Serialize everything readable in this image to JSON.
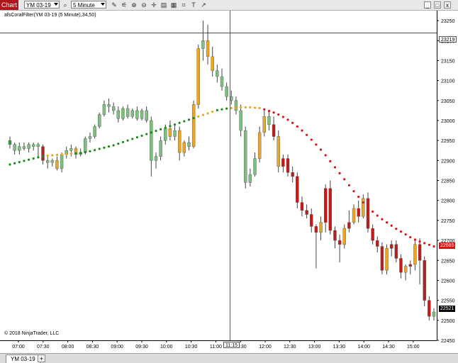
{
  "toolbar": {
    "chart_tab": "Chart",
    "instrument": "YM 03-19",
    "interval": "5 Minute",
    "icons": [
      "search-icon",
      "pencil-icon",
      "zoom-in-icon",
      "zoom-out-icon",
      "crosshair-icon",
      "properties-icon",
      "template-icon",
      "data-box-icon",
      "show-text-icon",
      "share-icon"
    ]
  },
  "window": {
    "minimize": "_",
    "maximize": "□",
    "close": "x"
  },
  "indicator_label": "afsCoralFilter(YM 03-19 (5 Minute),34,50)",
  "copyright": "© 2018 NinjaTrader, LLC",
  "crosshair": {
    "price_label": "23219",
    "time_label": "11:15"
  },
  "last_price": "22521",
  "filter_price": "22685",
  "colors": {
    "bull": "#7dc07d",
    "bear": "#c21a1a",
    "neutral": "#e8a623",
    "filter_up": "#1a8a1a",
    "filter_mid": "#e8a623",
    "filter_down": "#e01010"
  },
  "bottom": {
    "instrument_tab": "YM 03-19",
    "add_tab": "+"
  },
  "chart_data": {
    "type": "candlestick",
    "y_ticks": [
      "23250",
      "23200",
      "23150",
      "23100",
      "23050",
      "23000",
      "22950",
      "22900",
      "22850",
      "22800",
      "22750",
      "22700",
      "22650",
      "22600",
      "22550",
      "22500",
      "22450"
    ],
    "x_ticks": [
      "07:00",
      "07:30",
      "08:00",
      "08:30",
      "09:00",
      "09:30",
      "10:00",
      "10:30",
      "11:00",
      "11:30",
      "12:00",
      "12:30",
      "13:00",
      "13:30",
      "14:00",
      "14:30",
      "15:00"
    ],
    "ylim": [
      22450,
      23275
    ],
    "candles": [
      {
        "o": 22950,
        "h": 22960,
        "l": 22930,
        "c": 22940,
        "s": "b"
      },
      {
        "o": 22940,
        "h": 22945,
        "l": 22915,
        "c": 22925,
        "s": "g"
      },
      {
        "o": 22925,
        "h": 22945,
        "l": 22915,
        "c": 22935,
        "s": "g"
      },
      {
        "o": 22935,
        "h": 22945,
        "l": 22925,
        "c": 22930,
        "s": "g"
      },
      {
        "o": 22930,
        "h": 22945,
        "l": 22920,
        "c": 22940,
        "s": "g"
      },
      {
        "o": 22940,
        "h": 22945,
        "l": 22925,
        "c": 22935,
        "s": "g"
      },
      {
        "o": 22935,
        "h": 22945,
        "l": 22910,
        "c": 22940,
        "s": "g"
      },
      {
        "o": 22935,
        "h": 22940,
        "l": 22890,
        "c": 22900,
        "s": "r"
      },
      {
        "o": 22900,
        "h": 22910,
        "l": 22880,
        "c": 22895,
        "s": "g"
      },
      {
        "o": 22895,
        "h": 22905,
        "l": 22885,
        "c": 22900,
        "s": "g"
      },
      {
        "o": 22900,
        "h": 22910,
        "l": 22875,
        "c": 22880,
        "s": "n"
      },
      {
        "o": 22880,
        "h": 22920,
        "l": 22870,
        "c": 22915,
        "s": "g"
      },
      {
        "o": 22915,
        "h": 22935,
        "l": 22905,
        "c": 22925,
        "s": "g"
      },
      {
        "o": 22925,
        "h": 22940,
        "l": 22910,
        "c": 22930,
        "s": "g"
      },
      {
        "o": 22930,
        "h": 22935,
        "l": 22905,
        "c": 22915,
        "s": "n"
      },
      {
        "o": 22915,
        "h": 22930,
        "l": 22910,
        "c": 22920,
        "s": "g"
      },
      {
        "o": 22920,
        "h": 22960,
        "l": 22915,
        "c": 22955,
        "s": "g"
      },
      {
        "o": 22955,
        "h": 22970,
        "l": 22945,
        "c": 22960,
        "s": "g"
      },
      {
        "o": 22960,
        "h": 22990,
        "l": 22955,
        "c": 22985,
        "s": "g"
      },
      {
        "o": 22985,
        "h": 23020,
        "l": 22980,
        "c": 23015,
        "s": "g"
      },
      {
        "o": 23015,
        "h": 23050,
        "l": 23010,
        "c": 23040,
        "s": "g"
      },
      {
        "o": 23040,
        "h": 23055,
        "l": 23020,
        "c": 23035,
        "s": "g"
      },
      {
        "o": 23035,
        "h": 23045,
        "l": 23015,
        "c": 23025,
        "s": "g"
      },
      {
        "o": 23025,
        "h": 23035,
        "l": 22995,
        "c": 23005,
        "s": "g"
      },
      {
        "o": 23005,
        "h": 23035,
        "l": 23000,
        "c": 23030,
        "s": "g"
      },
      {
        "o": 23030,
        "h": 23040,
        "l": 23005,
        "c": 23010,
        "s": "g"
      },
      {
        "o": 23010,
        "h": 23030,
        "l": 23005,
        "c": 23025,
        "s": "g"
      },
      {
        "o": 23025,
        "h": 23035,
        "l": 23000,
        "c": 23005,
        "s": "g"
      },
      {
        "o": 23005,
        "h": 23030,
        "l": 23000,
        "c": 23025,
        "s": "g"
      },
      {
        "o": 23025,
        "h": 23035,
        "l": 22995,
        "c": 23000,
        "s": "g"
      },
      {
        "o": 23000,
        "h": 23010,
        "l": 22860,
        "c": 22900,
        "s": "g"
      },
      {
        "o": 22900,
        "h": 22920,
        "l": 22880,
        "c": 22910,
        "s": "g"
      },
      {
        "o": 22910,
        "h": 22960,
        "l": 22900,
        "c": 22950,
        "s": "g"
      },
      {
        "o": 22950,
        "h": 22990,
        "l": 22940,
        "c": 22980,
        "s": "g"
      },
      {
        "o": 22980,
        "h": 23000,
        "l": 22950,
        "c": 22960,
        "s": "n"
      },
      {
        "o": 22960,
        "h": 22990,
        "l": 22950,
        "c": 22975,
        "s": "g"
      },
      {
        "o": 22975,
        "h": 22985,
        "l": 22900,
        "c": 22920,
        "s": "n"
      },
      {
        "o": 22920,
        "h": 22950,
        "l": 22910,
        "c": 22945,
        "s": "n"
      },
      {
        "o": 22945,
        "h": 22960,
        "l": 22925,
        "c": 22935,
        "s": "g"
      },
      {
        "o": 22935,
        "h": 23050,
        "l": 22930,
        "c": 23040,
        "s": "n"
      },
      {
        "o": 23040,
        "h": 23190,
        "l": 23030,
        "c": 23180,
        "s": "n"
      },
      {
        "o": 23180,
        "h": 23250,
        "l": 23150,
        "c": 23200,
        "s": "g"
      },
      {
        "o": 23200,
        "h": 23240,
        "l": 23140,
        "c": 23160,
        "s": "n"
      },
      {
        "o": 23160,
        "h": 23185,
        "l": 23110,
        "c": 23125,
        "s": "n"
      },
      {
        "o": 23125,
        "h": 23140,
        "l": 23095,
        "c": 23110,
        "s": "g"
      },
      {
        "o": 23110,
        "h": 23130,
        "l": 23075,
        "c": 23085,
        "s": "g"
      },
      {
        "o": 23085,
        "h": 23095,
        "l": 23050,
        "c": 23060,
        "s": "g"
      },
      {
        "o": 23060,
        "h": 23075,
        "l": 23040,
        "c": 23050,
        "s": "g"
      },
      {
        "o": 23050,
        "h": 23060,
        "l": 23015,
        "c": 23025,
        "s": "g"
      },
      {
        "o": 23025,
        "h": 23040,
        "l": 22960,
        "c": 22975,
        "s": "g"
      },
      {
        "o": 22975,
        "h": 22985,
        "l": 22830,
        "c": 22845,
        "s": "g"
      },
      {
        "o": 22845,
        "h": 22880,
        "l": 22835,
        "c": 22865,
        "s": "g"
      },
      {
        "o": 22865,
        "h": 22920,
        "l": 22860,
        "c": 22905,
        "s": "g"
      },
      {
        "o": 22905,
        "h": 22985,
        "l": 22895,
        "c": 22970,
        "s": "n"
      },
      {
        "o": 22970,
        "h": 23030,
        "l": 22960,
        "c": 23010,
        "s": "n"
      },
      {
        "o": 23010,
        "h": 23025,
        "l": 22975,
        "c": 22990,
        "s": "g"
      },
      {
        "o": 22990,
        "h": 23010,
        "l": 22950,
        "c": 22960,
        "s": "r"
      },
      {
        "o": 22960,
        "h": 22975,
        "l": 22870,
        "c": 22885,
        "s": "n"
      },
      {
        "o": 22885,
        "h": 22915,
        "l": 22870,
        "c": 22905,
        "s": "r"
      },
      {
        "o": 22905,
        "h": 22915,
        "l": 22860,
        "c": 22870,
        "s": "r"
      },
      {
        "o": 22870,
        "h": 22885,
        "l": 22845,
        "c": 22860,
        "s": "r"
      },
      {
        "o": 22860,
        "h": 22870,
        "l": 22780,
        "c": 22795,
        "s": "r"
      },
      {
        "o": 22795,
        "h": 22810,
        "l": 22760,
        "c": 22775,
        "s": "r"
      },
      {
        "o": 22775,
        "h": 22790,
        "l": 22755,
        "c": 22765,
        "s": "r"
      },
      {
        "o": 22765,
        "h": 22780,
        "l": 22720,
        "c": 22735,
        "s": "r"
      },
      {
        "o": 22735,
        "h": 22740,
        "l": 22630,
        "c": 22720,
        "s": "r"
      },
      {
        "o": 22720,
        "h": 22760,
        "l": 22700,
        "c": 22745,
        "s": "n"
      },
      {
        "o": 22745,
        "h": 22840,
        "l": 22720,
        "c": 22830,
        "s": "r"
      },
      {
        "o": 22830,
        "h": 22850,
        "l": 22715,
        "c": 22725,
        "s": "r"
      },
      {
        "o": 22725,
        "h": 22735,
        "l": 22680,
        "c": 22700,
        "s": "r"
      },
      {
        "o": 22700,
        "h": 22715,
        "l": 22645,
        "c": 22690,
        "s": "r"
      },
      {
        "o": 22690,
        "h": 22740,
        "l": 22680,
        "c": 22730,
        "s": "n"
      },
      {
        "o": 22730,
        "h": 22775,
        "l": 22720,
        "c": 22745,
        "s": "r"
      },
      {
        "o": 22745,
        "h": 22790,
        "l": 22740,
        "c": 22780,
        "s": "n"
      },
      {
        "o": 22780,
        "h": 22800,
        "l": 22745,
        "c": 22760,
        "s": "r"
      },
      {
        "o": 22760,
        "h": 22815,
        "l": 22755,
        "c": 22805,
        "s": "n"
      },
      {
        "o": 22805,
        "h": 22820,
        "l": 22720,
        "c": 22730,
        "s": "r"
      },
      {
        "o": 22730,
        "h": 22740,
        "l": 22690,
        "c": 22700,
        "s": "r"
      },
      {
        "o": 22700,
        "h": 22710,
        "l": 22670,
        "c": 22685,
        "s": "r"
      },
      {
        "o": 22685,
        "h": 22695,
        "l": 22615,
        "c": 22625,
        "s": "r"
      },
      {
        "o": 22625,
        "h": 22690,
        "l": 22615,
        "c": 22680,
        "s": "n"
      },
      {
        "o": 22680,
        "h": 22700,
        "l": 22660,
        "c": 22690,
        "s": "r"
      },
      {
        "o": 22690,
        "h": 22700,
        "l": 22645,
        "c": 22655,
        "s": "r"
      },
      {
        "o": 22655,
        "h": 22665,
        "l": 22605,
        "c": 22620,
        "s": "r"
      },
      {
        "o": 22620,
        "h": 22640,
        "l": 22600,
        "c": 22635,
        "s": "n"
      },
      {
        "o": 22635,
        "h": 22650,
        "l": 22615,
        "c": 22640,
        "s": "r"
      },
      {
        "o": 22640,
        "h": 22700,
        "l": 22625,
        "c": 22690,
        "s": "n"
      },
      {
        "o": 22690,
        "h": 22705,
        "l": 22590,
        "c": 22650,
        "s": "r"
      },
      {
        "o": 22650,
        "h": 22660,
        "l": 22535,
        "c": 22550,
        "s": "r"
      },
      {
        "o": 22550,
        "h": 22560,
        "l": 22500,
        "c": 22510,
        "s": "r"
      },
      {
        "o": 22510,
        "h": 22530,
        "l": 22500,
        "c": 22521,
        "s": "g"
      }
    ],
    "filter": [
      22890,
      22893,
      22896,
      22899,
      22902,
      22905,
      22908,
      22910,
      22912,
      22913,
      22914,
      22915,
      22916,
      22917,
      22918,
      22919,
      22921,
      22923,
      22926,
      22929,
      22932,
      22935,
      22938,
      22942,
      22946,
      22950,
      22954,
      22958,
      22962,
      22966,
      22970,
      22974,
      22978,
      22982,
      22986,
      22990,
      22994,
      22998,
      23002,
      23006,
      23010,
      23014,
      23018,
      23022,
      23026,
      23028,
      23030,
      23031,
      23032,
      23033,
      23033,
      23033,
      23032,
      23031,
      23028,
      23024,
      23020,
      23015,
      23009,
      23002,
      22994,
      22985,
      22975,
      22964,
      22952,
      22940,
      22927,
      22913,
      22898,
      22883,
      22868,
      22853,
      22838,
      22823,
      22809,
      22795,
      22783,
      22772,
      22762,
      22753,
      22745,
      22737,
      22729,
      22722,
      22715,
      22708,
      22702,
      22697,
      22693,
      22689,
      22685
    ],
    "filter_colors": [
      "g",
      "g",
      "g",
      "g",
      "g",
      "g",
      "g",
      "g",
      "n",
      "n",
      "n",
      "n",
      "n",
      "n",
      "g",
      "g",
      "g",
      "g",
      "g",
      "g",
      "g",
      "g",
      "g",
      "g",
      "g",
      "g",
      "g",
      "g",
      "g",
      "g",
      "g",
      "g",
      "g",
      "g",
      "g",
      "g",
      "g",
      "g",
      "g",
      "g",
      "n",
      "n",
      "n",
      "n",
      "g",
      "g",
      "g",
      "n",
      "n",
      "n",
      "n",
      "n",
      "n",
      "n",
      "r"
    ]
  }
}
